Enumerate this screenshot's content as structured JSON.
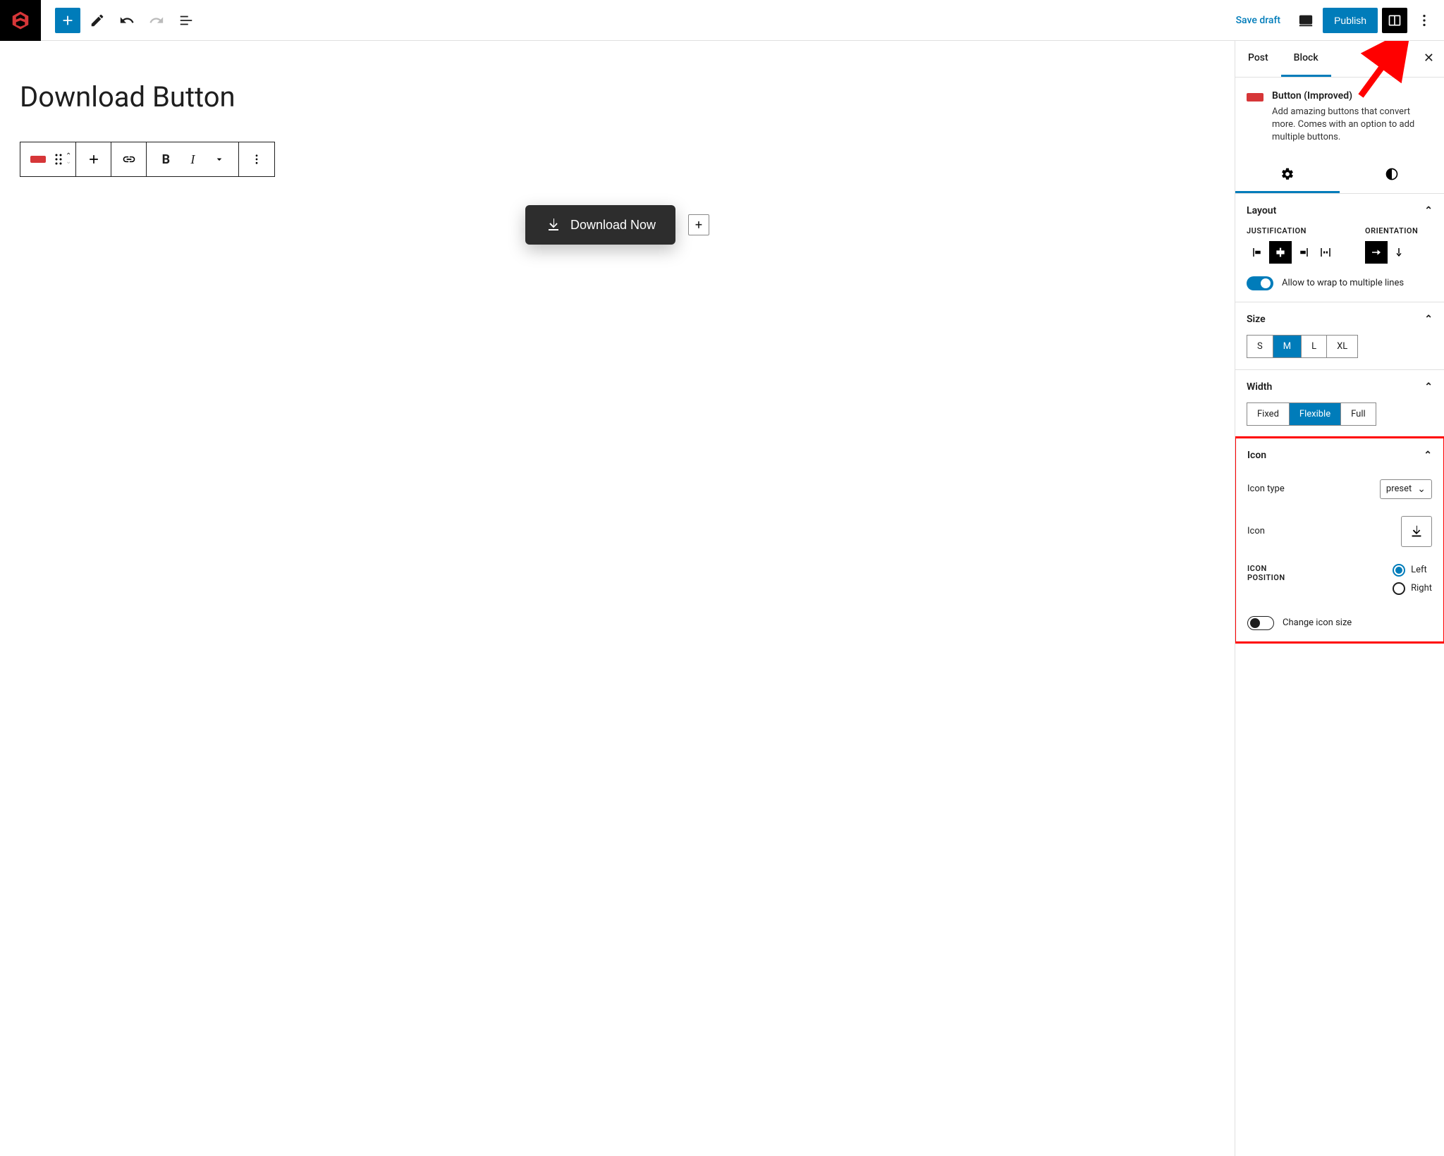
{
  "topbar": {
    "save_draft": "Save draft",
    "publish": "Publish"
  },
  "canvas": {
    "title": "Download Button",
    "button_text": "Download Now",
    "add_after": "+"
  },
  "sidebar": {
    "tabs": {
      "post": "Post",
      "block": "Block"
    },
    "block_title": "Button (Improved)",
    "block_desc": "Add amazing buttons that convert more. Comes with an option to add multiple buttons.",
    "layout": {
      "heading": "Layout",
      "justification": "JUSTIFICATION",
      "orientation": "ORIENTATION",
      "wrap_label": "Allow to wrap to multiple lines"
    },
    "size": {
      "heading": "Size",
      "options": [
        "S",
        "M",
        "L",
        "XL"
      ],
      "active": "M"
    },
    "width": {
      "heading": "Width",
      "options": [
        "Fixed",
        "Flexible",
        "Full"
      ],
      "active": "Flexible"
    },
    "icon": {
      "heading": "Icon",
      "type_label": "Icon type",
      "type_value": "preset",
      "icon_label": "Icon",
      "position_label": "ICON POSITION",
      "pos_left": "Left",
      "pos_right": "Right",
      "change_size": "Change icon size"
    }
  }
}
